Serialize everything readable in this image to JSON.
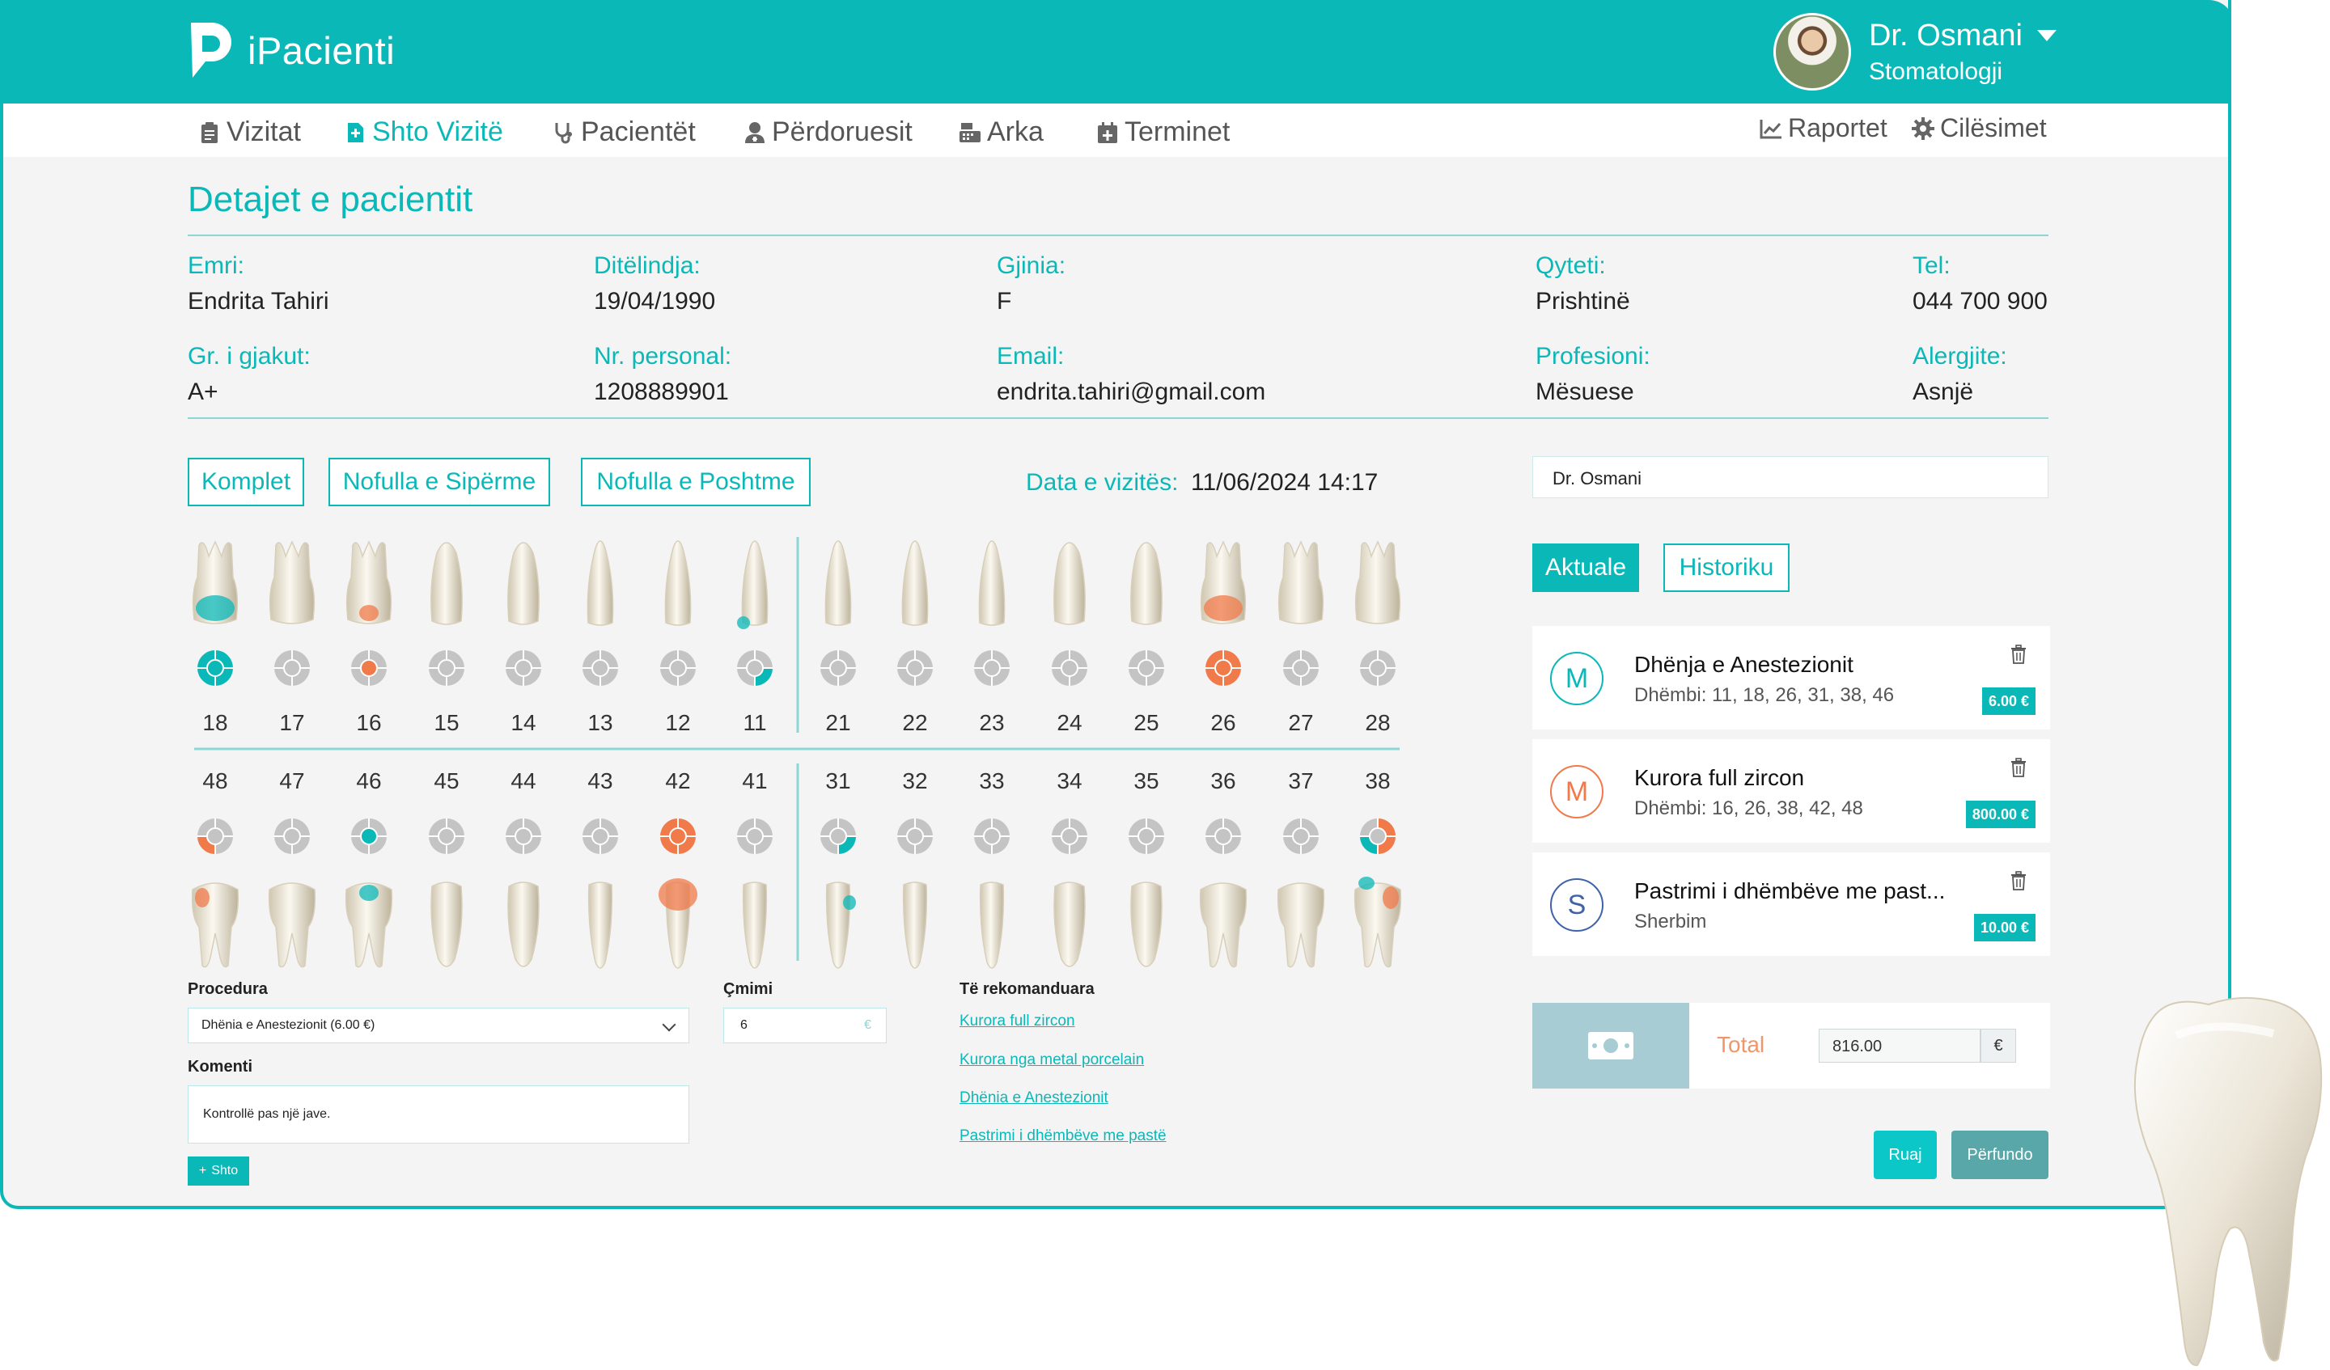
{
  "app": {
    "brand": "iPacienti"
  },
  "user": {
    "name": "Dr. Osmani",
    "role": "Stomatologji"
  },
  "nav": {
    "items": [
      {
        "label": "Vizitat",
        "icon": "clipboard-icon"
      },
      {
        "label": "Shto Vizitë",
        "icon": "add-document-icon",
        "active": true
      },
      {
        "label": "Pacientët",
        "icon": "stethoscope-icon"
      },
      {
        "label": "Përdoruesit",
        "icon": "user-doctor-icon"
      },
      {
        "label": "Arka",
        "icon": "cash-register-icon"
      },
      {
        "label": "Terminet",
        "icon": "calendar-plus-icon"
      }
    ],
    "right": [
      {
        "label": "Raportet",
        "icon": "chart-line-icon"
      },
      {
        "label": "Cilësimet",
        "icon": "gear-icon"
      }
    ]
  },
  "patient": {
    "section_title": "Detajet e pacientit",
    "fields": [
      {
        "label": "Emri:",
        "value": "Endrita Tahiri"
      },
      {
        "label": "Ditëlindja:",
        "value": "19/04/1990"
      },
      {
        "label": "Gjinia:",
        "value": "F"
      },
      {
        "label": "Qyteti:",
        "value": "Prishtinë"
      },
      {
        "label": "Tel:",
        "value": "044 700 900"
      },
      {
        "label": "Gr. i gjakut:",
        "value": "A+"
      },
      {
        "label": "Nr. personal:",
        "value": "1208889901"
      },
      {
        "label": "Email:",
        "value": "endrita.tahiri@gmail.com"
      },
      {
        "label": "Profesioni:",
        "value": "Mësuese"
      },
      {
        "label": "Alergjite:",
        "value": "Asnjë"
      }
    ]
  },
  "jaw_buttons": [
    "Komplet",
    "Nofulla e Sipërme",
    "Nofulla e Poshtme"
  ],
  "visit": {
    "date_label": "Data e vizitës:",
    "date_value": "11/06/2024 14:17"
  },
  "teeth": {
    "upper": [
      {
        "num": "18",
        "mark": "cyan-full"
      },
      {
        "num": "17",
        "mark": "none"
      },
      {
        "num": "16",
        "mark": "orange-center"
      },
      {
        "num": "15",
        "mark": "none"
      },
      {
        "num": "14",
        "mark": "none"
      },
      {
        "num": "13",
        "mark": "none"
      },
      {
        "num": "12",
        "mark": "none"
      },
      {
        "num": "11",
        "mark": "cyan-quarter"
      },
      {
        "num": "21",
        "mark": "none"
      },
      {
        "num": "22",
        "mark": "none"
      },
      {
        "num": "23",
        "mark": "none"
      },
      {
        "num": "24",
        "mark": "none"
      },
      {
        "num": "25",
        "mark": "none"
      },
      {
        "num": "26",
        "mark": "orange-full"
      },
      {
        "num": "27",
        "mark": "none"
      },
      {
        "num": "28",
        "mark": "none"
      }
    ],
    "lower": [
      {
        "num": "48",
        "mark": "orange-quarter"
      },
      {
        "num": "47",
        "mark": "none"
      },
      {
        "num": "46",
        "mark": "cyan-center"
      },
      {
        "num": "45",
        "mark": "none"
      },
      {
        "num": "44",
        "mark": "none"
      },
      {
        "num": "43",
        "mark": "none"
      },
      {
        "num": "42",
        "mark": "orange-full"
      },
      {
        "num": "41",
        "mark": "none"
      },
      {
        "num": "31",
        "mark": "cyan-quarter"
      },
      {
        "num": "32",
        "mark": "none"
      },
      {
        "num": "33",
        "mark": "none"
      },
      {
        "num": "34",
        "mark": "none"
      },
      {
        "num": "35",
        "mark": "none"
      },
      {
        "num": "36",
        "mark": "none"
      },
      {
        "num": "37",
        "mark": "none"
      },
      {
        "num": "38",
        "mark": "mixed"
      }
    ]
  },
  "form": {
    "procedure_label": "Procedura",
    "procedure_value": "Dhënia e Anestezionit (6.00 €)",
    "price_label": "Çmimi",
    "price_value": "6",
    "price_currency": "€",
    "comment_label": "Komenti",
    "comment_value": "Kontrollë pas një jave.",
    "add_label": "Shto",
    "recommended_label": "Të rekomanduara",
    "recommended": [
      "Kurora full zircon",
      "Kurora nga metal porcelain",
      "Dhënia e Anestezionit",
      "Pastrimi i dhëmbëve me pastë"
    ]
  },
  "side": {
    "doctor_value": "Dr. Osmani",
    "tabs": {
      "current": "Aktuale",
      "history": "Historiku"
    },
    "items": [
      {
        "badge": "M",
        "badge_color": "#0bb8b8",
        "title": "Dhënja e Anestezionit",
        "subtitle": "Dhëmbi: 11, 18, 26, 31, 38, 46",
        "price": "6.00 €"
      },
      {
        "badge": "M",
        "badge_color": "#f07a4a",
        "title": "Kurora full zircon",
        "subtitle": "Dhëmbi: 16, 26, 38, 42, 48",
        "price": "800.00 €"
      },
      {
        "badge": "S",
        "badge_color": "#3f63a8",
        "title": "Pastrimi i dhëmbëve me past...",
        "subtitle": "Sherbim",
        "price": "10.00 €"
      }
    ],
    "total_label": "Total",
    "total_value": "816.00",
    "total_currency": "€",
    "save_label": "Ruaj",
    "finish_label": "Përfundo"
  },
  "colors": {
    "accent": "#0bb8b8",
    "orange": "#f07a4a",
    "gray": "#c4c4c4"
  }
}
